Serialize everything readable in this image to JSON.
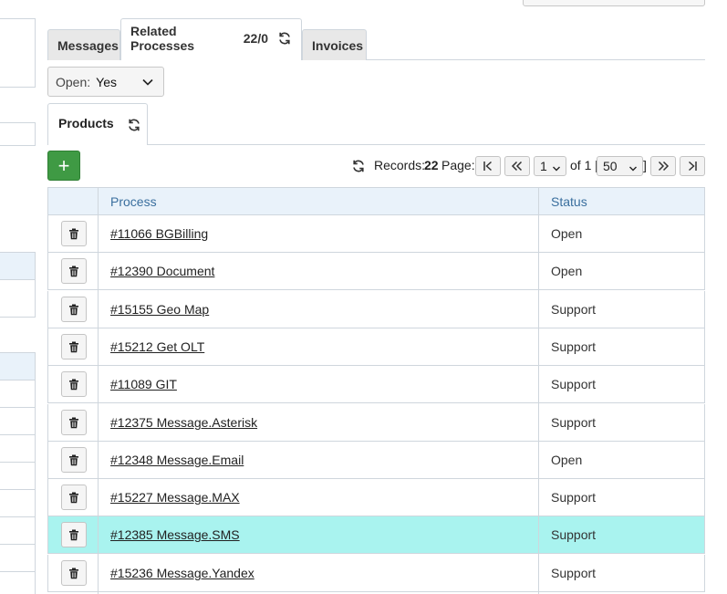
{
  "tabs": [
    {
      "label": "Messages"
    },
    {
      "label": "Related Processes",
      "count": "22/0",
      "active": true
    },
    {
      "label": "Invoices"
    }
  ],
  "filter": {
    "label": "Open:",
    "value": "Yes"
  },
  "subtab": {
    "label": "Products"
  },
  "add_button": {
    "label": "+"
  },
  "pager": {
    "records_label": "Records:",
    "records_count": "22",
    "page_label": "Page:",
    "page_value": "1",
    "of_text": "of 1 [",
    "per_page": "50",
    "close_bracket": "]"
  },
  "table": {
    "columns": [
      "Process",
      "Status"
    ],
    "rows": [
      {
        "process": "#11066 BGBilling",
        "status": "Open"
      },
      {
        "process": "#12390 Document",
        "status": "Open"
      },
      {
        "process": "#15155 Geo Map",
        "status": "Support"
      },
      {
        "process": "#15212 Get OLT",
        "status": "Support"
      },
      {
        "process": "#11089 GIT",
        "status": "Support"
      },
      {
        "process": "#12375 Message.Asterisk",
        "status": "Support"
      },
      {
        "process": "#12348 Message.Email",
        "status": "Open"
      },
      {
        "process": "#15227 Message.MAX",
        "status": "Support"
      },
      {
        "process": "#12385 Message.SMS",
        "status": "Support",
        "highlighted": true
      },
      {
        "process": "#15236 Message.Yandex",
        "status": "Support"
      }
    ]
  },
  "colors": {
    "accent": "#3f9a44",
    "header_bg": "#e9f2fa",
    "highlight": "#a9f3ef",
    "header_text": "#3a6f9e"
  },
  "icons": {
    "refresh": "refresh-icon",
    "delete": "trash-icon",
    "add": "plus-icon"
  }
}
